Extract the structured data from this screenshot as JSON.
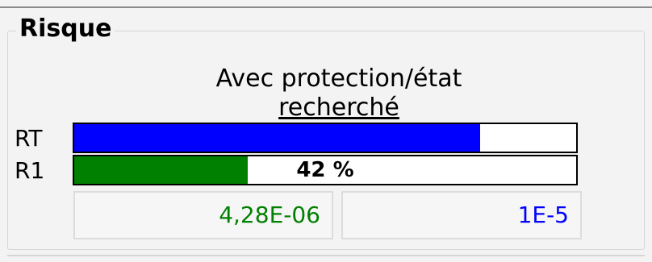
{
  "group": {
    "title": "Risque"
  },
  "subtitle": {
    "line1": "Avec protection/état",
    "line2": "recherché"
  },
  "bars": [
    {
      "label": "RT",
      "fill_fraction": 0.808,
      "color": "#0000ff",
      "text": ""
    },
    {
      "label": "R1",
      "fill_fraction": 0.345,
      "color": "#008000",
      "text": "42 %"
    }
  ],
  "values": {
    "current": {
      "text": "4,28E-06",
      "color": "#008000"
    },
    "target": {
      "text": "1E-5",
      "color": "#0000ff"
    }
  }
}
